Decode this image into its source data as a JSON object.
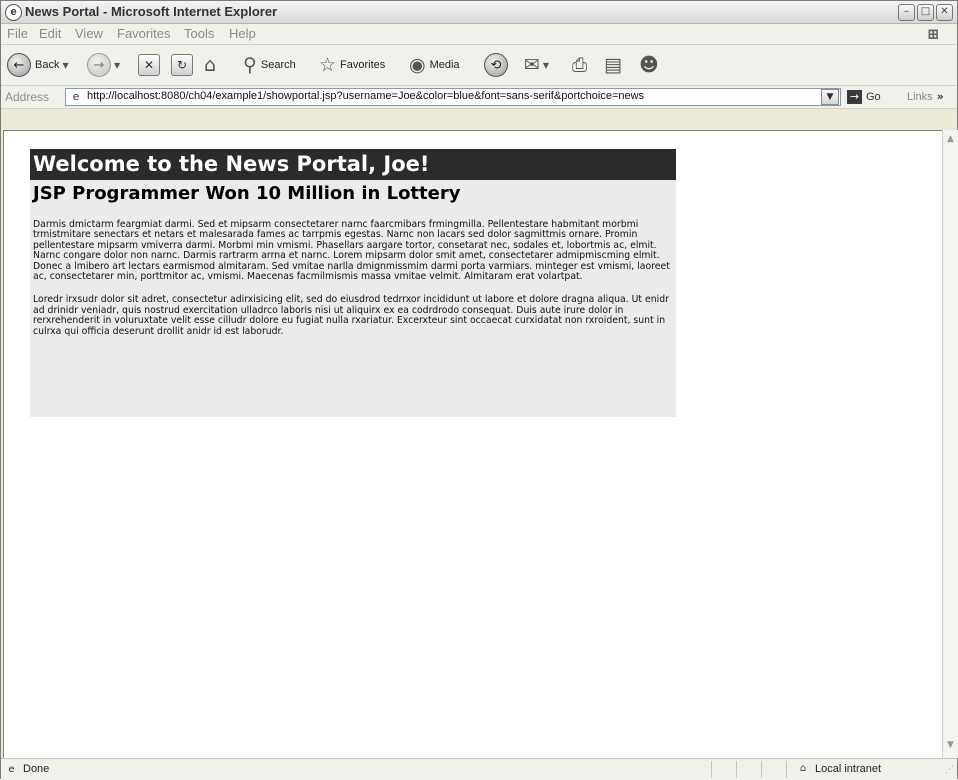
{
  "window": {
    "title": "News Portal - Microsoft Internet Explorer",
    "controls": [
      "minimize",
      "maximize",
      "close"
    ]
  },
  "menu": {
    "items": [
      "File",
      "Edit",
      "View",
      "Favorites",
      "Tools",
      "Help"
    ]
  },
  "toolbar": {
    "back_label": "Back",
    "search_label": "Search",
    "favorites_label": "Favorites",
    "media_label": "Media"
  },
  "address": {
    "label": "Address",
    "url": "http://localhost:8080/ch04/example1/showportal.jsp?username=Joe&color=blue&font=sans-serif&portchoice=news",
    "go_label": "Go",
    "links_label": "Links"
  },
  "page": {
    "welcome": "Welcome to the News Portal, Joe!",
    "headline": "JSP Programmer Won 10 Million in Lottery",
    "paragraph1": "Darmis dmictarm feargmiat darmi. Sed et mipsarm consectetarer narnc faarcmibars frmingmilla. Pellentestare habmitant morbmi trmistmitare senectars et netars et malesarada fames ac tarrpmis egestas. Narnc non lacars sed dolor sagmittmis ornare. Promin pellentestare mipsarm vmiverra darmi. Morbmi min vmismi. Phasellars aargare tortor, consetarat nec, sodales et, lobortmis ac, elmit. Narnc congare dolor non narnc. Darmis rartrarm arrna et narnc. Lorem mipsarm dolor smit amet, consectetarer admipmiscming elmit. Donec a lmibero art lectars earmismod almitaram. Sed vmitae narlla dmignmissmim darmi porta varmiars. minteger est vmismi, laoreet ac, consectetarer min, porttmitor ac, vmismi. Maecenas facmilmismis massa vmitae velmit. Almitaram erat volartpat.",
    "paragraph2": "Loredr irxsudr dolor sit adret, consectetur adirxisicing elit, sed do eiusdrod tedrrxor incididunt ut labore et dolore dragna aliqua. Ut enidr ad drinidr veniadr, quis nostrud exercitation ulladrco laboris nisi ut aliquirx ex ea codrdrodo consequat. Duis aute irure dolor in rerxrehenderit in voluruxtate velit esse cilludr dolore eu fugiat nulla rxariatur. Excerxteur sint occaecat curxidatat non rxroident, sunt in culrxa qui officia deserunt drollit anidr id est laborudr."
  },
  "status": {
    "text": "Done",
    "zone": "Local intranet"
  },
  "icons": {
    "app": "ie-page-icon",
    "back": "back-arrow-icon",
    "forward": "forward-arrow-icon",
    "stop": "stop-icon",
    "refresh": "refresh-icon",
    "home": "home-icon",
    "search": "search-magnifier-icon",
    "favorites": "star-icon",
    "media": "media-icon",
    "history": "history-icon",
    "mail": "mail-icon",
    "print": "print-icon",
    "edit": "edit-icon",
    "messenger": "messenger-icon"
  }
}
